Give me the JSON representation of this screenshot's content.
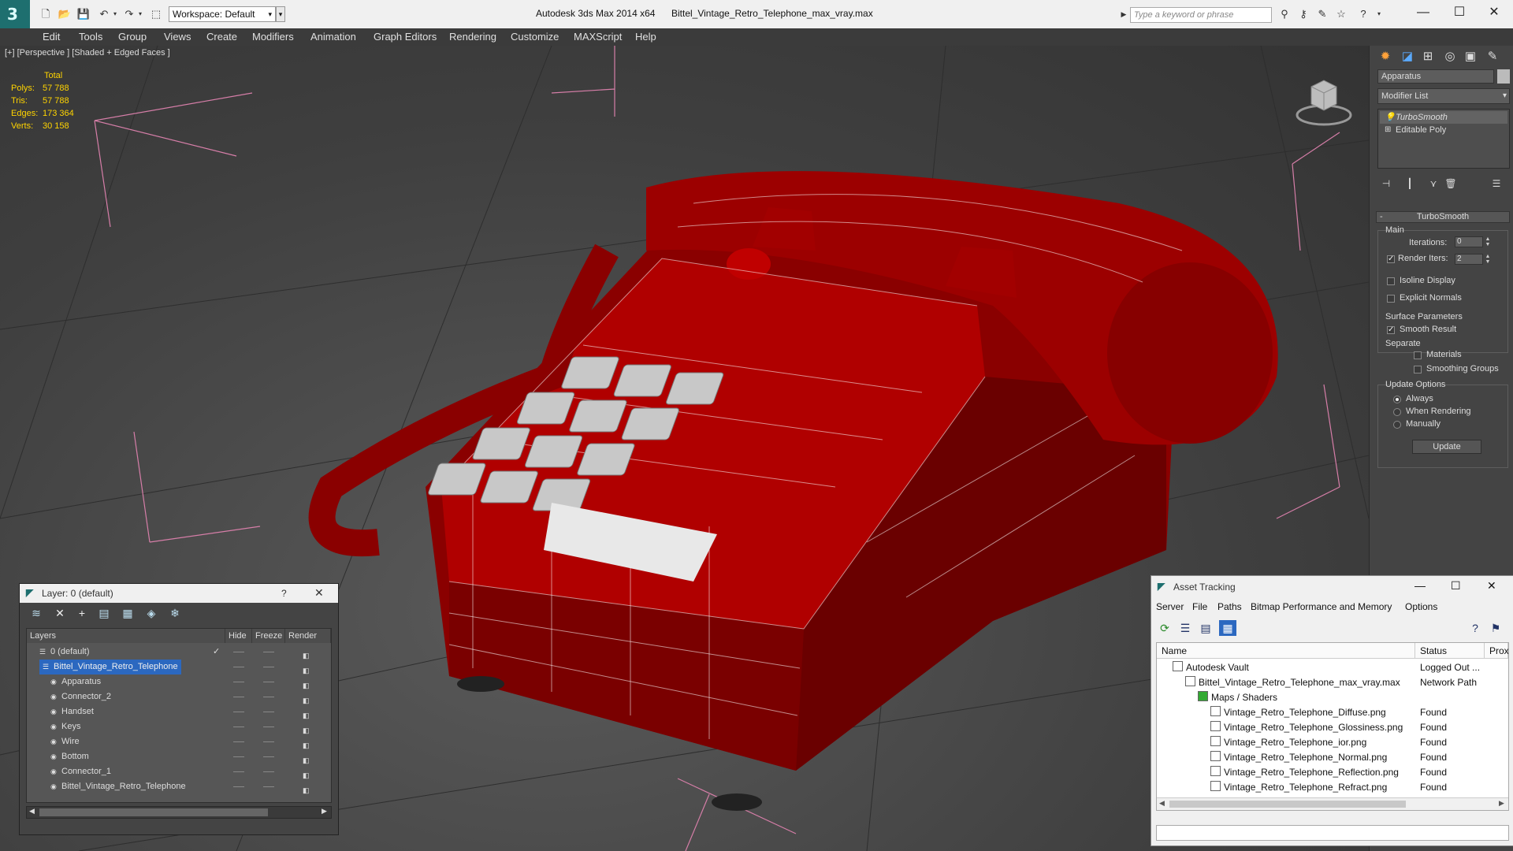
{
  "titlebar": {
    "workspace": "Workspace: Default",
    "app_title": "Autodesk 3ds Max  2014 x64",
    "file_title": "Bittel_Vintage_Retro_Telephone_max_vray.max",
    "search_placeholder": "Type a keyword or phrase"
  },
  "menu": [
    "Edit",
    "Tools",
    "Group",
    "Views",
    "Create",
    "Modifiers",
    "Animation",
    "Graph Editors",
    "Rendering",
    "Customize",
    "MAXScript",
    "Help"
  ],
  "viewport": {
    "label": "[+] [Perspective ] [Shaded + Edged Faces ]",
    "stats": {
      "header": "Total",
      "rows": [
        {
          "label": "Polys:",
          "value": "57 788"
        },
        {
          "label": "Tris:",
          "value": "57 788"
        },
        {
          "label": "Edges:",
          "value": "173 364"
        },
        {
          "label": "Verts:",
          "value": "30 158"
        }
      ]
    },
    "model_color": "#a00000"
  },
  "command_panel": {
    "object_name": "Apparatus",
    "modifier_list": "Modifier List",
    "stack": [
      "TurboSmooth",
      "Editable Poly"
    ],
    "turbosmooth": {
      "title": "TurboSmooth",
      "main": "Main",
      "iterations_label": "Iterations:",
      "iterations_value": "0",
      "render_iters_label": "Render Iters:",
      "render_iters_value": "2",
      "isoline": "Isoline Display",
      "explicit_normals": "Explicit Normals",
      "surface_params": "Surface Parameters",
      "smooth_result": "Smooth Result",
      "separate": "Separate",
      "materials": "Materials",
      "smoothing_groups": "Smoothing Groups",
      "update_options": "Update Options",
      "always": "Always",
      "when_rendering": "When Rendering",
      "manually": "Manually",
      "update_button": "Update"
    }
  },
  "layer_panel": {
    "title": "Layer: 0 (default)",
    "help": "?",
    "columns": [
      "Layers",
      "Hide",
      "Freeze",
      "Render"
    ],
    "rows": [
      {
        "name": "0 (default)",
        "indent": 0,
        "current": true,
        "selected": false
      },
      {
        "name": "Bittel_Vintage_Retro_Telephone",
        "indent": 0,
        "current": false,
        "selected": true
      },
      {
        "name": "Apparatus",
        "indent": 1,
        "current": false,
        "selected": false
      },
      {
        "name": "Connector_2",
        "indent": 1,
        "current": false,
        "selected": false
      },
      {
        "name": "Handset",
        "indent": 1,
        "current": false,
        "selected": false
      },
      {
        "name": "Keys",
        "indent": 1,
        "current": false,
        "selected": false
      },
      {
        "name": "Wire",
        "indent": 1,
        "current": false,
        "selected": false
      },
      {
        "name": "Bottom",
        "indent": 1,
        "current": false,
        "selected": false
      },
      {
        "name": "Connector_1",
        "indent": 1,
        "current": false,
        "selected": false
      },
      {
        "name": "Bittel_Vintage_Retro_Telephone",
        "indent": 1,
        "current": false,
        "selected": false
      }
    ]
  },
  "asset_tracking": {
    "title": "Asset Tracking",
    "menu": [
      "Server",
      "File",
      "Paths",
      "Bitmap Performance and Memory",
      "Options"
    ],
    "columns": [
      "Name",
      "Status",
      "Prox"
    ],
    "rows": [
      {
        "name": "Autodesk Vault",
        "status": "Logged Out ...",
        "indent": 1
      },
      {
        "name": "Bittel_Vintage_Retro_Telephone_max_vray.max",
        "status": "Network Path",
        "indent": 2
      },
      {
        "name": "Maps / Shaders",
        "status": "",
        "indent": 3
      },
      {
        "name": "Vintage_Retro_Telephone_Diffuse.png",
        "status": "Found",
        "indent": 4
      },
      {
        "name": "Vintage_Retro_Telephone_Glossiness.png",
        "status": "Found",
        "indent": 4
      },
      {
        "name": "Vintage_Retro_Telephone_ior.png",
        "status": "Found",
        "indent": 4
      },
      {
        "name": "Vintage_Retro_Telephone_Normal.png",
        "status": "Found",
        "indent": 4
      },
      {
        "name": "Vintage_Retro_Telephone_Reflection.png",
        "status": "Found",
        "indent": 4
      },
      {
        "name": "Vintage_Retro_Telephone_Refract.png",
        "status": "Found",
        "indent": 4
      }
    ]
  }
}
